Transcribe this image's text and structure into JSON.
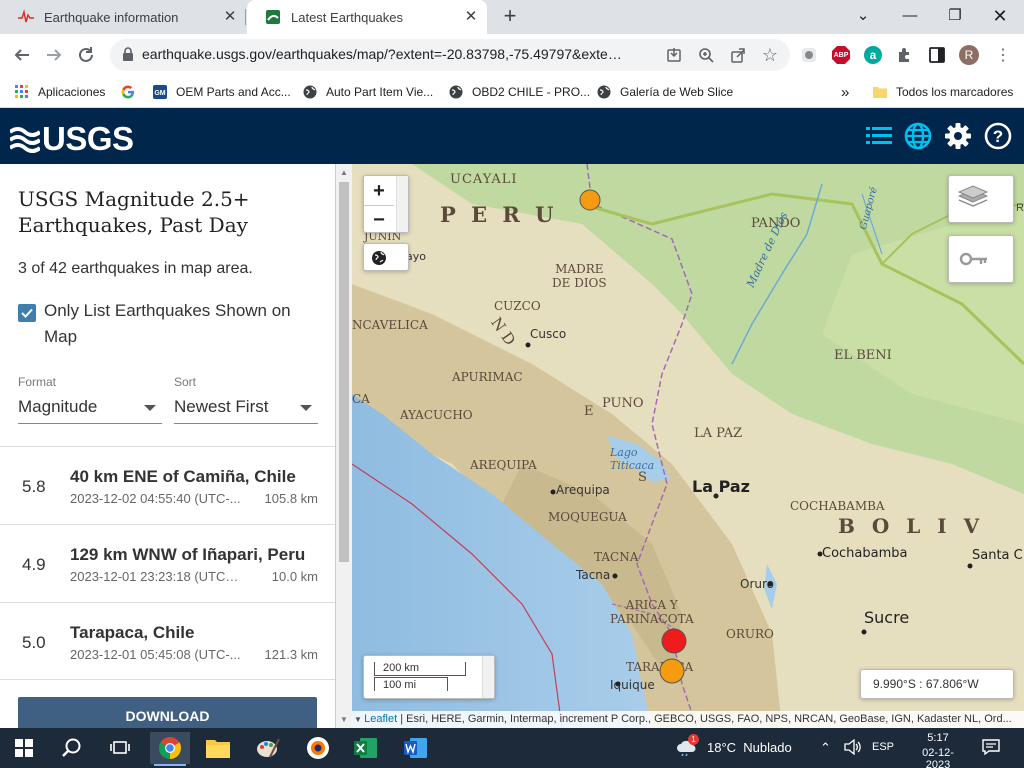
{
  "browser": {
    "tabs": [
      {
        "title": "Earthquake information",
        "active": false
      },
      {
        "title": "Latest Earthquakes",
        "active": true
      }
    ],
    "url": "earthquake.usgs.gov/earthquakes/map/?extent=-20.83798,-75.49797&extent=-9....",
    "bookmarks": [
      {
        "label": "Aplicaciones",
        "icon": "apps-grid-icon"
      },
      {
        "label": "",
        "icon": "google-icon"
      },
      {
        "label": "OEM Parts and Acc...",
        "icon": "gm-icon"
      },
      {
        "label": "Auto Part Item Vie...",
        "icon": "globe-icon"
      },
      {
        "label": "OBD2 CHILE - PRO...",
        "icon": "globe-icon"
      },
      {
        "label": "Galería de Web Slice",
        "icon": "globe-icon"
      }
    ],
    "bookmarks_overflow": "»",
    "all_bookmarks": "Todos los marcadores",
    "ext_abp": "ABP",
    "profile_initial": "R"
  },
  "usgs": {
    "logo_text": "USGS"
  },
  "sidebar": {
    "title": "USGS Magnitude 2.5+ Earthquakes, Past Day",
    "count_text": "3 of 42 earthquakes in map area.",
    "only_list_label": "Only List Earthquakes Shown on Map",
    "only_list_checked": true,
    "format_label": "Format",
    "format_value": "Magnitude",
    "sort_label": "Sort",
    "sort_value": "Newest First",
    "earthquakes": [
      {
        "mag": "5.8",
        "place": "40 km ENE of Camiña, Chile",
        "time": "2023-12-02 04:55:40 (UTC-...",
        "depth": "105.8 km"
      },
      {
        "mag": "4.9",
        "place": "129 km WNW of Iñapari, Peru",
        "time": "2023-12-01 23:23:18 (UTC-0...",
        "depth": "10.0 km"
      },
      {
        "mag": "5.0",
        "place": "Tarapaca, Chile",
        "time": "2023-12-01 05:45:08 (UTC-...",
        "depth": "121.3 km"
      }
    ],
    "download_label": "DOWNLOAD"
  },
  "map": {
    "zoom_in": "+",
    "zoom_out": "−",
    "scale_km": "200 km",
    "scale_mi": "100 mi",
    "coords": "9.990°S : 67.806°W",
    "attribution_link": "Leaflet",
    "attribution_text": " | Esri, HERE, Garmin, Intermap, increment P Corp., GEBCO, USGS, FAO, NPS, NRCAN, GeoBase, IGN, Kadaster NL, Ord...",
    "labels": {
      "ucayali": "UCAYALI",
      "peru": "P E R U",
      "pando": "PANDO",
      "madre_de_dios": "MADRE\nDE DIOS",
      "cuzco_region": "CUZCO",
      "huancavelica": "NCAVELICA",
      "cusco": "Cusco",
      "apurimac": "APURIMAC",
      "el_beni": "EL BENI",
      "ayacucho": "AYACUCHO",
      "puno": "PUNO",
      "la_paz_region": "LA PAZ",
      "lago_titicaca": "Lago\nTiticaca",
      "la_paz": "La Paz",
      "arequipa_region": "AREQUIPA",
      "arequipa": "Arequipa",
      "moquegua": "MOQUEGUA",
      "cochabamba_region": "COCHABAMBA",
      "bolivia": "B O L I V",
      "tacna_region": "TACNA",
      "cochabamba": "Cochabamba",
      "santa_cruz": "Santa C",
      "tacna": "Tacna",
      "oruro": "Oruro",
      "arica": "ARICA Y\nPARINACOTA",
      "sucre": "Sucre",
      "oruro_region": "ORURO",
      "tarapaca": "TARAPACA",
      "iquique": "Iquique",
      "madre_de_dios_river": "Madre de Dios",
      "guapore": "Guaporé",
      "nde": "N   D",
      "junin": "JUNIN",
      "ayo": "ayo",
      "ca": "CA",
      "de": "E",
      "s": "S"
    }
  },
  "taskbar": {
    "weather_badge": "1",
    "weather": "18°C  Nublado",
    "lang": "ESP",
    "time": "5:17",
    "date": "02-12-2023"
  }
}
